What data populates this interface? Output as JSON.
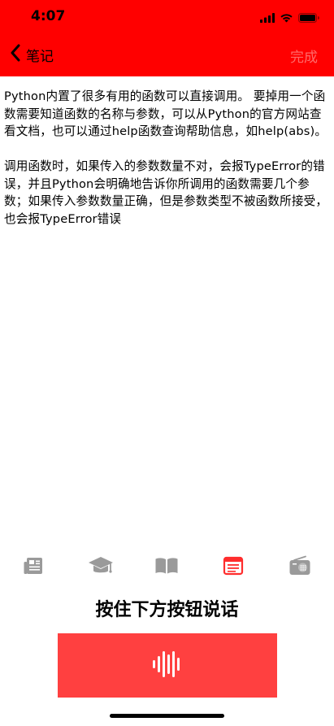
{
  "status_bar": {
    "time": "4:07",
    "signal_icon": "signal-bars-icon",
    "wifi_icon": "wifi-icon",
    "battery_icon": "battery-icon"
  },
  "nav": {
    "back_label": "笔记",
    "back_icon": "chevron-left-icon",
    "done_label": "完成"
  },
  "note": {
    "text": "Python内置了很多有用的函数可以直接调用。 要掉用一个函数需要知道函数的名称与参数，可以从Python的官方网站查看文档，也可以通过help函数查询帮助信息，如help(abs)。\n\n调用函数时，如果传入的参数数量不对，会报TypeError的错误，并且Python会明确地告诉你所调用的函数需要几个参数；如果传入参数数量正确，但是参数类型不被函数所接受，也会报TypeError错误"
  },
  "toolbar": {
    "items": [
      {
        "icon": "newspaper-icon",
        "active": false
      },
      {
        "icon": "graduation-cap-icon",
        "active": false
      },
      {
        "icon": "open-book-icon",
        "active": false
      },
      {
        "icon": "note-card-icon",
        "active": true
      },
      {
        "icon": "radio-icon",
        "active": false
      }
    ]
  },
  "voice": {
    "hint": "按住下方按钮说话",
    "button_icon": "sound-wave-icon"
  },
  "colors": {
    "header_bg": "#ff0000",
    "done_text": "#ff6a6a",
    "talk_button_bg": "#ff4040",
    "toolbar_inactive": "#9a9a9a",
    "toolbar_active": "#ff2d2d"
  }
}
